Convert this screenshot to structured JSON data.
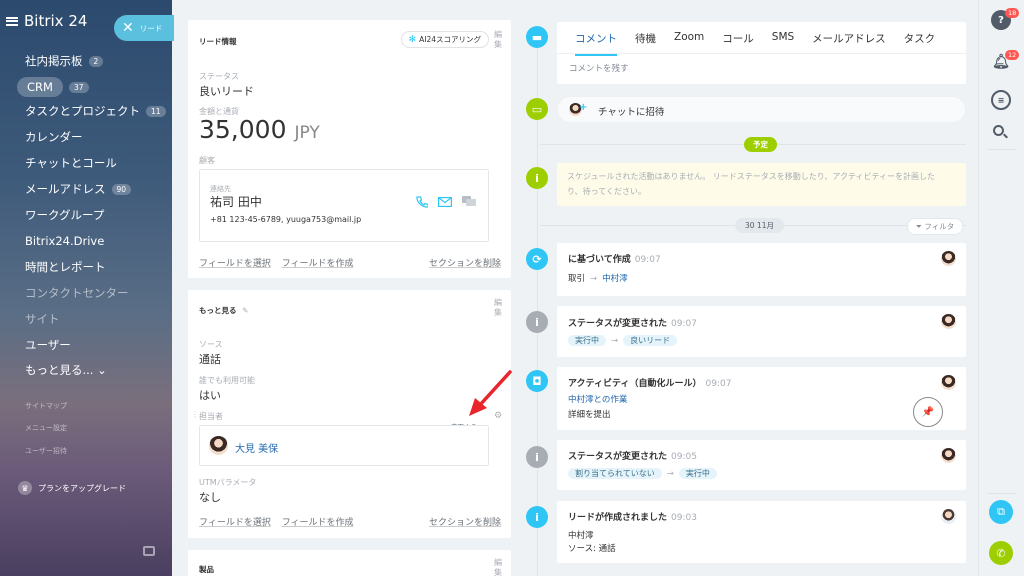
{
  "sidebar": {
    "brand": "Bitrix 24",
    "lead_pill": "リード",
    "items": [
      {
        "label": "社内掲示板",
        "badge": "2"
      },
      {
        "label": "CRM",
        "badge": "37"
      },
      {
        "label": "タスクとプロジェクト",
        "badge": "11"
      },
      {
        "label": "カレンダー",
        "badge": ""
      },
      {
        "label": "チャットとコール",
        "badge": ""
      },
      {
        "label": "メールアドレス",
        "badge": "90"
      },
      {
        "label": "ワークグループ",
        "badge": ""
      },
      {
        "label": "Bitrix24.Drive",
        "badge": ""
      },
      {
        "label": "時間とレポート",
        "badge": ""
      },
      {
        "label": "コンタクトセンター",
        "badge": ""
      },
      {
        "label": "サイト",
        "badge": ""
      },
      {
        "label": "ユーザー",
        "badge": ""
      },
      {
        "label": "もっと見る... ⌄",
        "badge": ""
      }
    ],
    "sitemap": "サイトマップ",
    "menu_settings": "メニュー設定",
    "invite": "ユーザー招待",
    "upgrade": "プランをアップグレード"
  },
  "lead_info": {
    "title": "リード情報",
    "ai_button": "AI24スコアリング",
    "edit": "編集",
    "status_label": "ステータス",
    "status_value": "良いリード",
    "amount_label": "金額と通貨",
    "amount_value": "35,000",
    "currency": "JPY",
    "client_label": "顧客",
    "contact_label": "連絡先",
    "contact_name": "祐司 田中",
    "contact_details": "+81 123-45-6789, yuuga753@mail.jp",
    "select_field": "フィールドを選択",
    "create_field": "フィールドを作成",
    "delete_section": "セクションを削除"
  },
  "more": {
    "title": "もっと見る",
    "edit": "編集",
    "source_label": "ソース",
    "source_value": "通話",
    "available_label": "誰でも利用可能",
    "available_value": "はい",
    "responsible_label": "担当者",
    "change": "変更する",
    "responsible_name": "大見 美保",
    "utm_label": "UTMパラメータ",
    "utm_value": "なし",
    "select_field": "フィールドを選択",
    "create_field": "フィールドを作成",
    "delete_section": "セクションを削除"
  },
  "products": {
    "title": "製品",
    "edit": "編集"
  },
  "timeline": {
    "tabs": [
      "コメント",
      "待機",
      "Zoom",
      "コール",
      "SMS",
      "メールアドレス",
      "タスク"
    ],
    "comment_placeholder": "コメントを残す",
    "chat_invite": "チャットに招待",
    "planned": "予定",
    "schedule_text": "スケジュールされた活動はありません。 リードステータスを移動したり、アクティビティーを計画したり、待ってください。",
    "date": "30 11月",
    "filter": "フィルタ",
    "events": [
      {
        "title": "に基づいて作成",
        "time": "09:07",
        "from": "取引",
        "to": "中村澪"
      },
      {
        "title": "ステータスが変更された",
        "time": "09:07",
        "from": "実行中",
        "to": "良いリード"
      },
      {
        "title": "アクティビティ（自動化ルール）",
        "time": "09:07",
        "line1": "中村澪との作業",
        "line2": "詳細を提出"
      },
      {
        "title": "ステータスが変更された",
        "time": "09:05",
        "from": "割り当てられていない",
        "to": "実行中"
      },
      {
        "title": "リードが作成されました",
        "time": "09:03",
        "line1": "中村澪",
        "line2": "ソース: 通話"
      }
    ]
  },
  "right_strip": {
    "help_badge": "18",
    "notif_badge": "12"
  },
  "colors": {
    "accent": "#2fc6f6",
    "green": "#9dcf00",
    "link": "#2067b0",
    "badge_red": "#ff5752"
  }
}
